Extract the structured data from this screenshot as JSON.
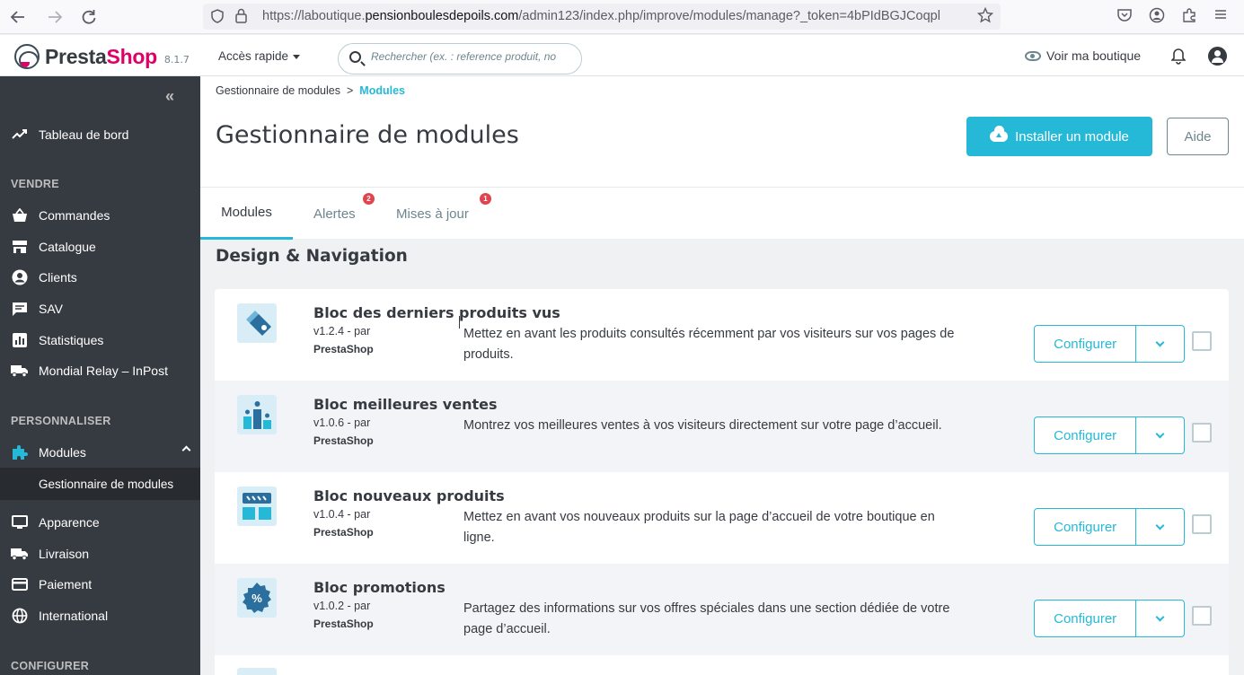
{
  "browser": {
    "url_prefix": "https://laboutique.",
    "url_domain": "pensionboulesdepoils.com",
    "url_path": "/admin123/index.php/improve/modules/manage?_token=4bPIdBGJCoqpl"
  },
  "header": {
    "logo_presta": "Presta",
    "logo_shop": "Shop",
    "version": "8.1.7",
    "quick_access": "Accès rapide",
    "search_placeholder": "Rechercher (ex. : reference produit, no",
    "view_shop": "Voir ma boutique"
  },
  "sidebar": {
    "dashboard": "Tableau de bord",
    "section_sell": "VENDRE",
    "sell_items": [
      "Commandes",
      "Catalogue",
      "Clients",
      "SAV",
      "Statistiques",
      "Mondial Relay – InPost"
    ],
    "section_customize": "PERSONNALISER",
    "modules": "Modules",
    "modules_sub": "Gestionnaire de modules",
    "customize_items": [
      "Apparence",
      "Livraison",
      "Paiement",
      "International"
    ],
    "section_configure": "CONFIGURER"
  },
  "breadcrumb": {
    "parent": "Gestionnaire de modules",
    "separator": ">",
    "current": "Modules"
  },
  "page": {
    "title": "Gestionnaire de modules",
    "install_button": "Installer un module",
    "help_button": "Aide"
  },
  "tabs": [
    {
      "label": "Modules",
      "badge": ""
    },
    {
      "label": "Alertes",
      "badge": "2"
    },
    {
      "label": "Mises à jour",
      "badge": "1"
    }
  ],
  "category": "Design & Navigation",
  "modules": [
    {
      "name": "Bloc des derniers produits vus",
      "version": "v1.2.4 - par",
      "author": "PrestaShop",
      "description": "Mettez en avant les produits consultés récemment par vos visiteurs sur vos pages de produits.",
      "action": "Configurer"
    },
    {
      "name": "Bloc meilleures ventes",
      "version": "v1.0.6 - par",
      "author": "PrestaShop",
      "description": "Montrez vos meilleures ventes à vos visiteurs directement sur votre page d’accueil.",
      "action": "Configurer"
    },
    {
      "name": "Bloc nouveaux produits",
      "version": "v1.0.4 - par",
      "author": "PrestaShop",
      "description": "Mettez en avant vos nouveaux produits sur la page d’accueil de votre boutique en ligne.",
      "action": "Configurer"
    },
    {
      "name": "Bloc promotions",
      "version": "v1.0.2 - par",
      "author": "PrestaShop",
      "description": "Partagez des informations sur vos offres spéciales dans une section dédiée de votre page d’accueil.",
      "action": "Configurer"
    }
  ],
  "colors": {
    "accent": "#25b9d7",
    "sidebar": "#363a41",
    "badge": "#e0454f",
    "brand_pink": "#df0067"
  }
}
